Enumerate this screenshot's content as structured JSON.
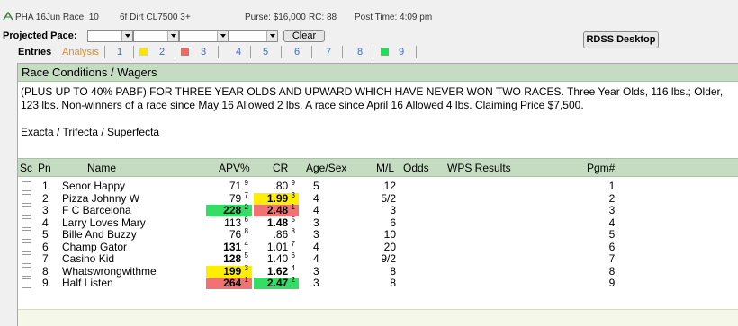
{
  "header": {
    "race": "PHA 16Jun Race: 10",
    "conditions": "6f Dirt  CL7500  3+",
    "purse": "Purse: $16,000",
    "rc": "RC: 88",
    "post_time": "Post Time: 4:09 pm"
  },
  "pace": {
    "label": "Projected Pace:",
    "clear": "Clear"
  },
  "rdss_button": "RDSS Desktop",
  "tabs": [
    {
      "label": "Entries"
    },
    {
      "label": "Analysis"
    },
    {
      "label": "1"
    },
    {
      "label": "2",
      "color": "#f5e800"
    },
    {
      "label": "3",
      "color": "#e86a6a"
    },
    {
      "label": "4"
    },
    {
      "label": "5"
    },
    {
      "label": "6"
    },
    {
      "label": "7"
    },
    {
      "label": "8"
    },
    {
      "label": "9",
      "color": "#22dd55"
    }
  ],
  "race_conditions": {
    "title": "Race Conditions / Wagers",
    "text": "(PLUS UP TO 40% PABF) FOR THREE YEAR OLDS AND UPWARD WHICH HAVE NEVER WON TWO RACES. Three Year Olds, 116 lbs.; Older, 123 lbs. Non-winners of a race since May 16 Allowed 2 lbs. A race since April 16 Allowed 4 lbs. Claiming Price $7,500.",
    "wagers": "Exacta / Trifecta / Superfecta"
  },
  "columns": {
    "sc": "Sc",
    "pn": "Pn",
    "name": "Name",
    "apv": "APV%",
    "cr": "CR",
    "agesex": "Age/Sex",
    "ml": "M/L",
    "odds": "Odds",
    "wps": "WPS Results",
    "pgm": "Pgm#"
  },
  "highlight_colors": {
    "green": "#33dd66",
    "yellow": "#ffee00",
    "red": "#f07272"
  },
  "entries": [
    {
      "pn": "1",
      "name": "Senor Happy",
      "apv": "71",
      "apv_rank": "9",
      "cr": ".80",
      "cr_rank": "9",
      "age": "5",
      "ml": "12",
      "pgm": "1"
    },
    {
      "pn": "2",
      "name": "Pizza Johnny W",
      "apv": "79",
      "apv_rank": "7",
      "cr": "1.99",
      "cr_rank": "3",
      "cr_hl": "yellow",
      "age": "4",
      "ml": "5/2",
      "pgm": "2"
    },
    {
      "pn": "3",
      "name": "F C Barcelona",
      "apv": "228",
      "apv_rank": "2",
      "apv_hl": "green",
      "cr": "2.48",
      "cr_rank": "1",
      "cr_hl": "red",
      "age": "4",
      "ml": "3",
      "pgm": "3"
    },
    {
      "pn": "4",
      "name": "Larry Loves Mary",
      "apv": "113",
      "apv_rank": "6",
      "cr": "1.48",
      "cr_rank": "5",
      "age": "3",
      "ml": "6",
      "pgm": "4"
    },
    {
      "pn": "5",
      "name": "Bille And Buzzy",
      "apv": "76",
      "apv_rank": "8",
      "cr": ".86",
      "cr_rank": "8",
      "age": "3",
      "ml": "10",
      "pgm": "5"
    },
    {
      "pn": "6",
      "name": "Champ Gator",
      "apv": "131",
      "apv_rank": "4",
      "cr": "1.01",
      "cr_rank": "7",
      "age": "4",
      "ml": "20",
      "pgm": "6"
    },
    {
      "pn": "7",
      "name": "Casino Kid",
      "apv": "128",
      "apv_rank": "5",
      "cr": "1.40",
      "cr_rank": "6",
      "age": "4",
      "ml": "9/2",
      "pgm": "7"
    },
    {
      "pn": "8",
      "name": "Whatswrongwithme",
      "apv": "199",
      "apv_rank": "3",
      "apv_hl": "yellow",
      "cr": "1.62",
      "cr_rank": "4",
      "age": "3",
      "ml": "8",
      "pgm": "8"
    },
    {
      "pn": "9",
      "name": "Half Listen",
      "apv": "264",
      "apv_rank": "1",
      "apv_hl": "red",
      "cr": "2.47",
      "cr_rank": "2",
      "cr_hl": "green",
      "age": "3",
      "ml": "8",
      "pgm": "9"
    }
  ]
}
